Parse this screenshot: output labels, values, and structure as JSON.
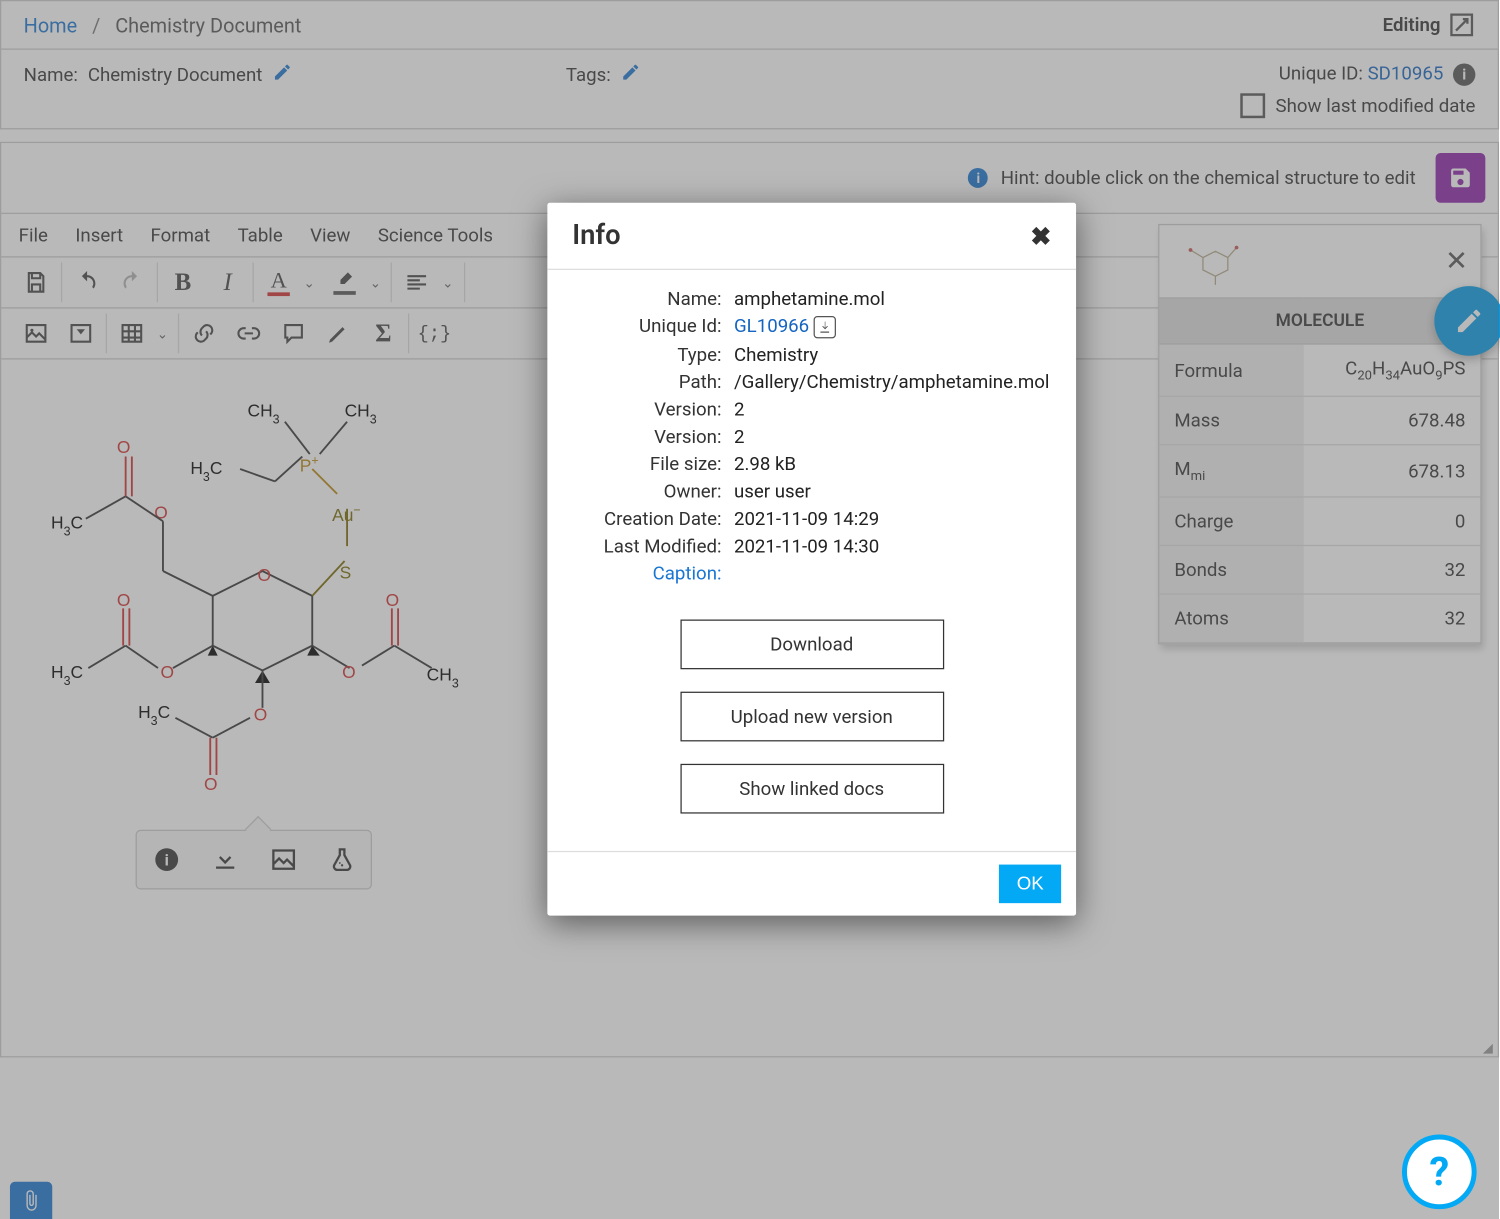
{
  "breadcrumb": {
    "home": "Home",
    "current": "Chemistry Document"
  },
  "editing_label": "Editing",
  "meta": {
    "name_label": "Name:",
    "name_value": "Chemistry Document",
    "tags_label": "Tags:",
    "unique_id_label": "Unique ID:",
    "unique_id": "SD10965",
    "show_last_modified": "Show last modified date"
  },
  "hint": "Hint: double click on the chemical structure to edit",
  "menubar": [
    "File",
    "Insert",
    "Format",
    "Table",
    "View",
    "Science Tools"
  ],
  "fontsize": "14px",
  "molecule_panel": {
    "header": "MOLECULE",
    "rows": [
      {
        "label": "Formula",
        "value_html": "C<sub>20</sub>H<sub>34</sub>AuO<sub>9</sub>PS"
      },
      {
        "label": "Mass",
        "value": "678.48"
      },
      {
        "label_html": "M<sub>mi</sub>",
        "value": "678.13"
      },
      {
        "label": "Charge",
        "value": "0"
      },
      {
        "label": "Bonds",
        "value": "32"
      },
      {
        "label": "Atoms",
        "value": "32"
      }
    ]
  },
  "modal": {
    "title": "Info",
    "rows": {
      "name_label": "Name:",
      "name": "amphetamine.mol",
      "uid_label": "Unique Id:",
      "uid": "GL10966",
      "type_label": "Type:",
      "type": "Chemistry",
      "path_label": "Path:",
      "path": "/Gallery/Chemistry/amphetamine.mol",
      "version1_label": "Version:",
      "version1": "2",
      "version2_label": "Version:",
      "version2": "2",
      "size_label": "File size:",
      "size": "2.98 kB",
      "owner_label": "Owner:",
      "owner": "user user",
      "created_label": "Creation Date:",
      "created": "2021-11-09 14:29",
      "modified_label": "Last Modified:",
      "modified": "2021-11-09 14:30",
      "caption_label": "Caption:"
    },
    "buttons": {
      "download": "Download",
      "upload": "Upload new version",
      "linked": "Show linked docs",
      "ok": "OK"
    }
  }
}
